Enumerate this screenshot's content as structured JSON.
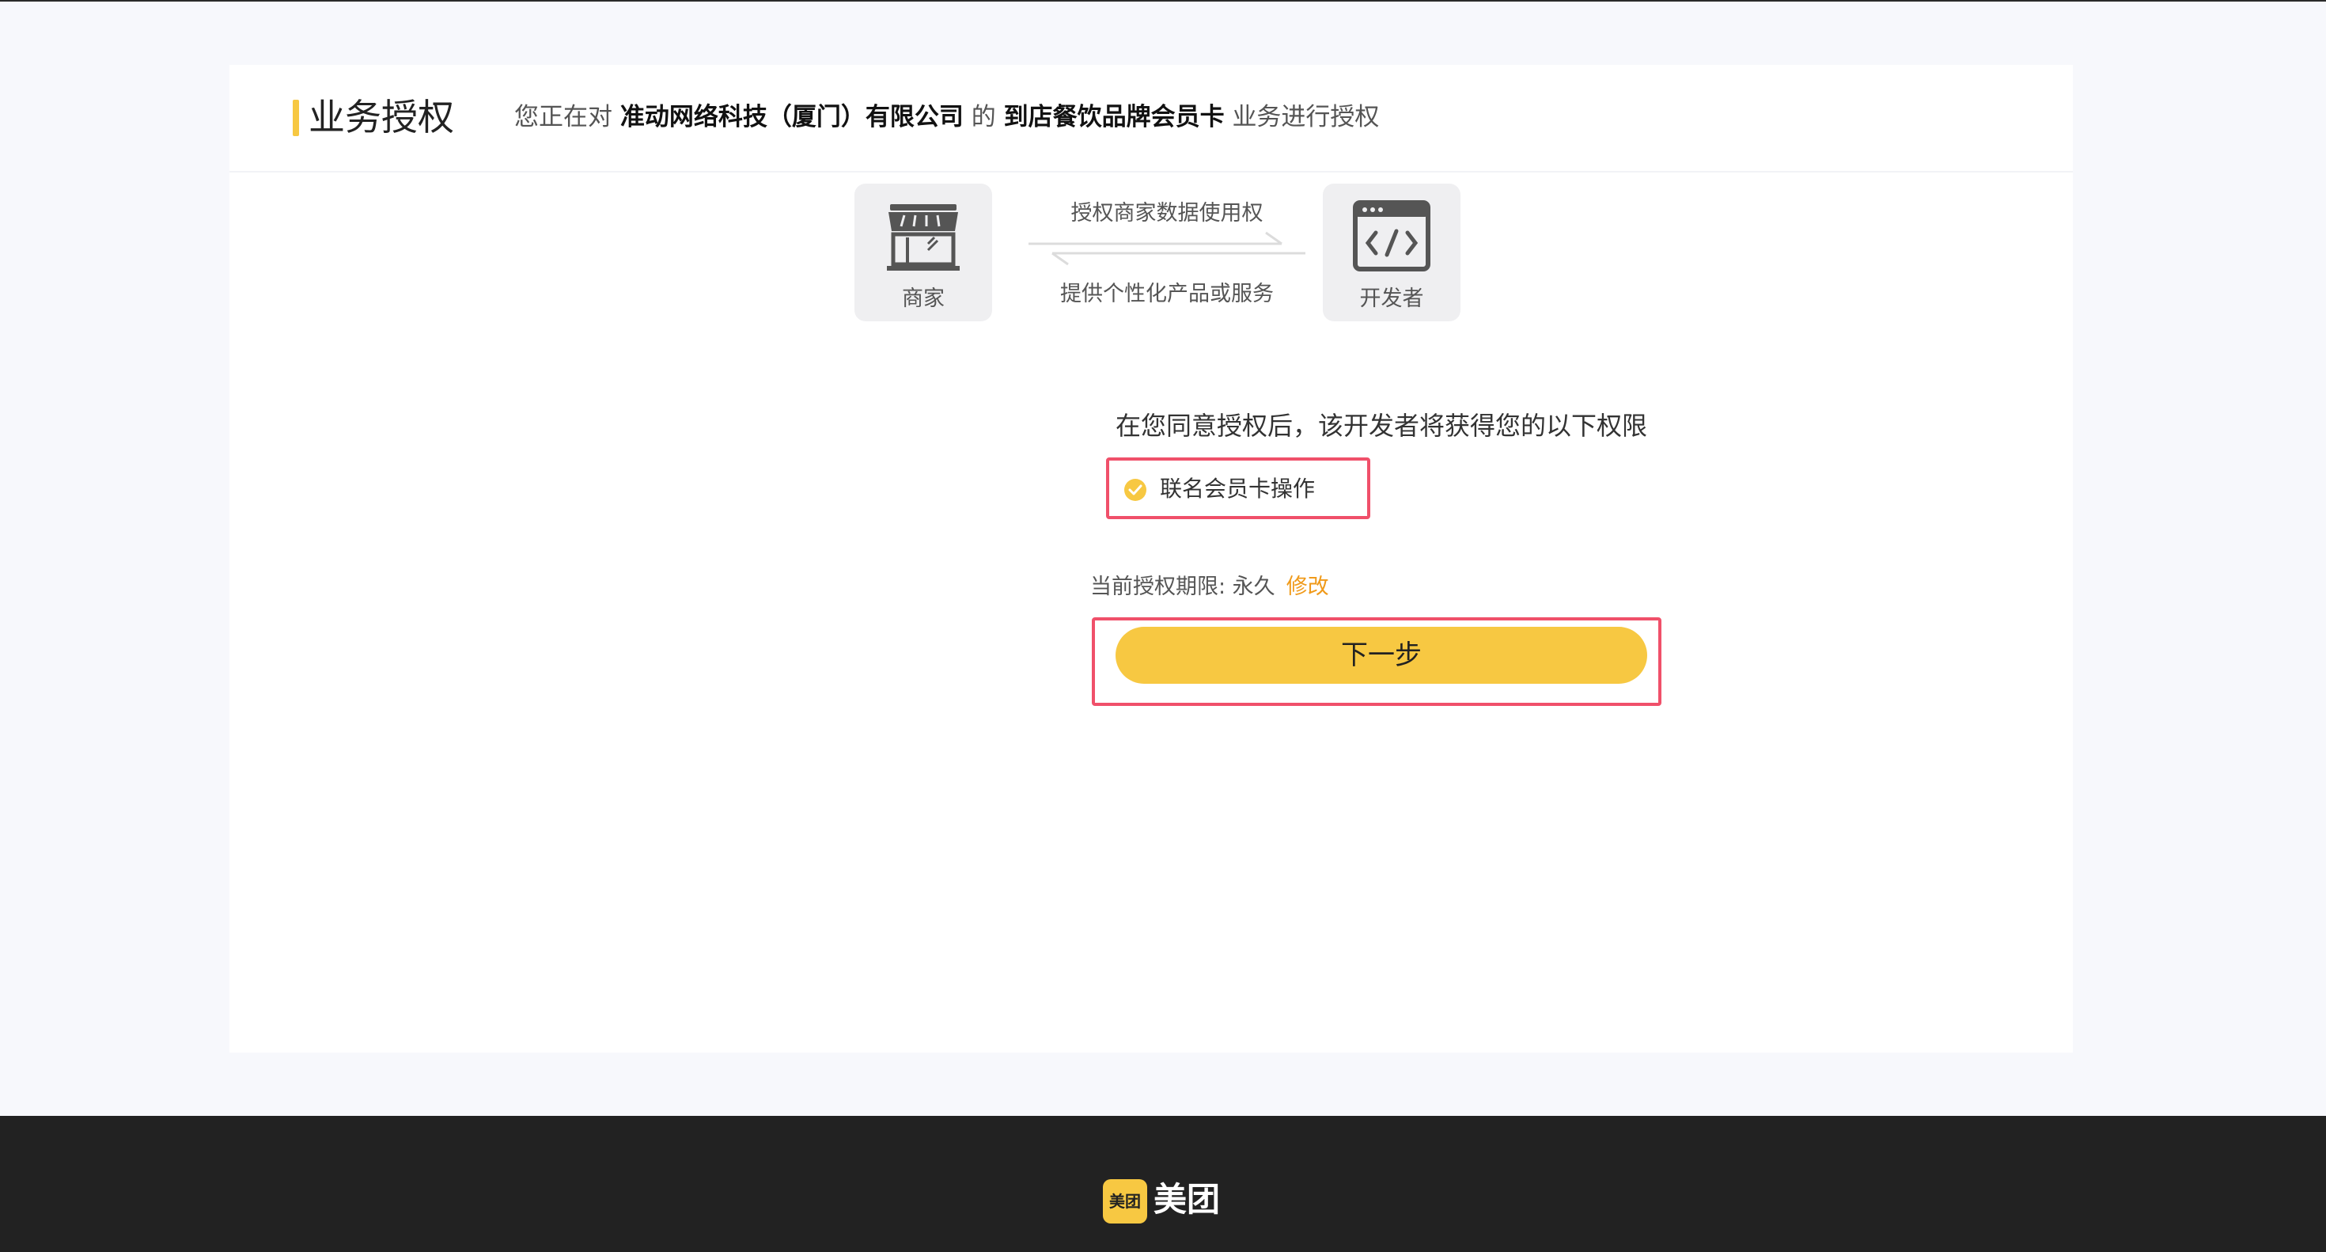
{
  "header": {
    "title": "业务授权",
    "prefix": "您正在对",
    "company": "准动网络科技（厦门）有限公司",
    "connector": "的",
    "business": "到店餐饮品牌会员卡",
    "suffix": "业务进行授权"
  },
  "flow": {
    "merchant_label": "商家",
    "merchant_icon": "store-icon",
    "developer_label": "开发者",
    "developer_icon": "code-window-icon",
    "top_text": "授权商家数据使用权",
    "bottom_text": "提供个性化产品或服务"
  },
  "permissions": {
    "intro": "在您同意授权后，该开发者将获得您的以下权限",
    "items": [
      {
        "label": "联名会员卡操作",
        "checked": true,
        "icon": "check-circle-icon"
      }
    ]
  },
  "period": {
    "label": "当前授权期限: 永久",
    "modify_label": "修改"
  },
  "next_button": {
    "label": "下一步"
  },
  "footer": {
    "logo_text": "美团",
    "brand_name": "美团"
  },
  "colors": {
    "accent": "#f7c842",
    "highlight_border": "#f0506a",
    "link": "#f09a1a",
    "footer_bg": "#222222",
    "page_bg": "#f7f8fc"
  }
}
